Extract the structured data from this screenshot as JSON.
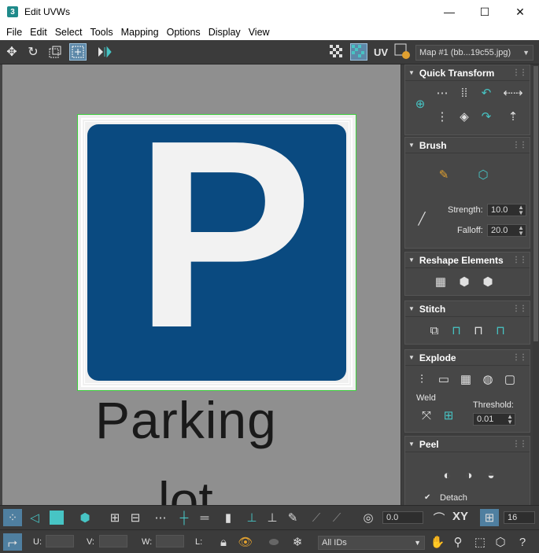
{
  "window": {
    "title": "Edit UVWs",
    "app_icon_label": "3",
    "controls": {
      "minimize": "—",
      "maximize": "☐",
      "close": "✕"
    }
  },
  "menu": [
    "File",
    "Edit",
    "Select",
    "Tools",
    "Mapping",
    "Options",
    "Display",
    "View"
  ],
  "toolbar": {
    "uv_label": "UV",
    "map_select": "Map #1 (bb...19c55.jpg)"
  },
  "viewport": {
    "sign_letter": "P",
    "text_line1": "Parking",
    "text_line2": "lot"
  },
  "panel": {
    "quick_transform": {
      "title": "Quick Transform"
    },
    "brush": {
      "title": "Brush",
      "strength_label": "Strength:",
      "strength_value": "10.0",
      "falloff_label": "Falloff:",
      "falloff_value": "20.0"
    },
    "reshape": {
      "title": "Reshape Elements"
    },
    "stitch": {
      "title": "Stitch"
    },
    "explode": {
      "title": "Explode",
      "weld_label": "Weld",
      "threshold_label": "Threshold:",
      "threshold_value": "0.01"
    },
    "peel": {
      "title": "Peel",
      "detach_label": "Detach",
      "detach_checked": "✔"
    }
  },
  "bottom": {
    "angle_value": "0.0",
    "xy_label": "XY",
    "grid_value": "16",
    "u_label": "U:",
    "v_label": "V:",
    "w_label": "W:",
    "l_label": "L:",
    "ids_select": "All IDs"
  },
  "colors": {
    "accent_teal": "#47c4c4",
    "sign_blue": "#0a4a80",
    "uv_green": "#3ecf3e",
    "panel_bg": "#3d3d3d"
  }
}
